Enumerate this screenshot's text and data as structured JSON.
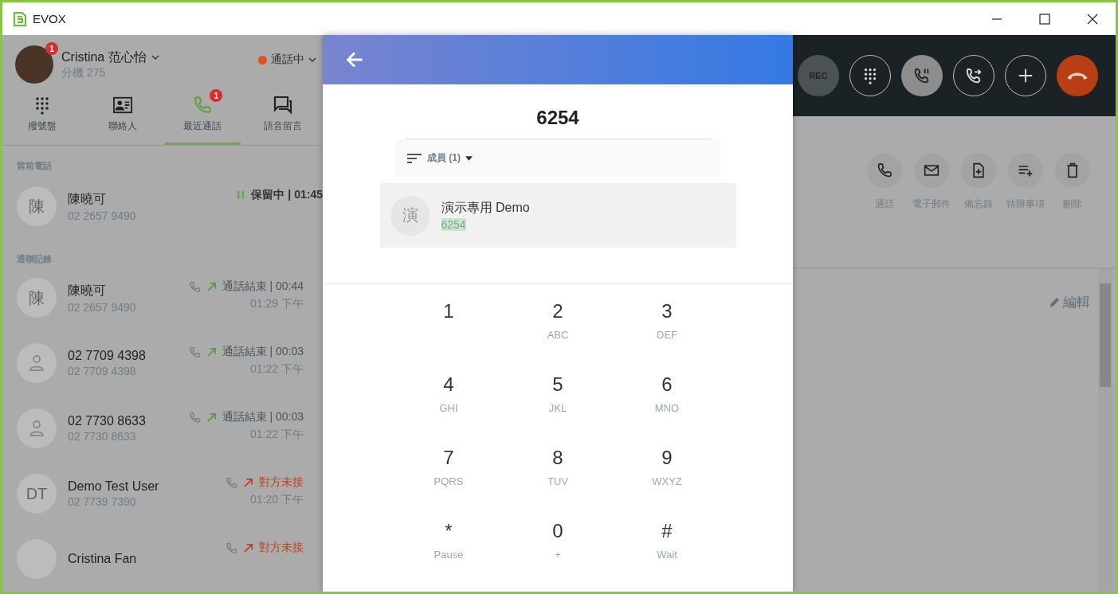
{
  "window": {
    "title": "EVOX"
  },
  "user": {
    "name": "Cristina 范心怡",
    "extension": "分機 275",
    "badge": "1",
    "status": "通話中"
  },
  "tabs": [
    {
      "label": "撥號盤",
      "selected": false
    },
    {
      "label": "聯絡人",
      "selected": false
    },
    {
      "label": "最近通話",
      "selected": true,
      "badge": "1"
    },
    {
      "label": "語音留言",
      "selected": false
    }
  ],
  "current_section": "當前電話",
  "current_call": {
    "avatar": "陳",
    "name": "陳曉可",
    "number": "02 2657 9490",
    "status": "保留中 | 01:45"
  },
  "history_section": "通聯記錄",
  "history": [
    {
      "generic_avatar": false,
      "avatar": "陳",
      "name": "陳曉可",
      "number": "02 2657 9490",
      "kind": "ended",
      "status": "通話結束 | 00:44",
      "time": "01:29 下午"
    },
    {
      "generic_avatar": true,
      "name": "02 7709 4398",
      "number": "02 7709 4398",
      "kind": "ended",
      "status": "通話結束 | 00:03",
      "time": "01:22 下午"
    },
    {
      "generic_avatar": true,
      "name": "02 7730 8633",
      "number": "02 7730 8633",
      "kind": "ended",
      "status": "通話結束 | 00:03",
      "time": "01:22 下午"
    },
    {
      "generic_avatar": false,
      "avatar": "DT",
      "name": "Demo Test User",
      "number": "02 7739 7390",
      "kind": "missed",
      "status": "對方未接",
      "time": "01:20 下午"
    },
    {
      "generic_avatar": false,
      "name": "Cristina Fan",
      "kind": "missed",
      "status": "對方未接"
    }
  ],
  "dialer": {
    "number": "6254",
    "filter": "成員 (1)",
    "results": [
      {
        "avatar": "演",
        "name": "演示專用 Demo",
        "number": "6254",
        "match_highlight": true
      }
    ],
    "keys": [
      {
        "digit": "1"
      },
      {
        "digit": "2",
        "letters": "ABC"
      },
      {
        "digit": "3",
        "letters": "DEF"
      },
      {
        "digit": "4",
        "letters": "GHI"
      },
      {
        "digit": "5",
        "letters": "JKL"
      },
      {
        "digit": "6",
        "letters": "MNO"
      },
      {
        "digit": "7",
        "letters": "PQRS"
      },
      {
        "digit": "8",
        "letters": "TUV"
      },
      {
        "digit": "9",
        "letters": "WXYZ"
      },
      {
        "digit": "*",
        "letters": "Pause"
      },
      {
        "digit": "0",
        "letters": "+"
      },
      {
        "digit": "#",
        "letters": "Wait"
      }
    ]
  },
  "call_controls": [
    {
      "kind": "filled",
      "label": "REC"
    },
    {
      "kind": "outline"
    },
    {
      "kind": "active"
    },
    {
      "kind": "outline"
    },
    {
      "kind": "outline"
    },
    {
      "kind": "danger"
    }
  ],
  "actions": [
    {
      "label": "通話"
    },
    {
      "label": "電子郵件"
    },
    {
      "label": "備忘錄"
    },
    {
      "label": "待辦事項"
    },
    {
      "label": "刪除"
    }
  ],
  "edit_label": "編輯"
}
